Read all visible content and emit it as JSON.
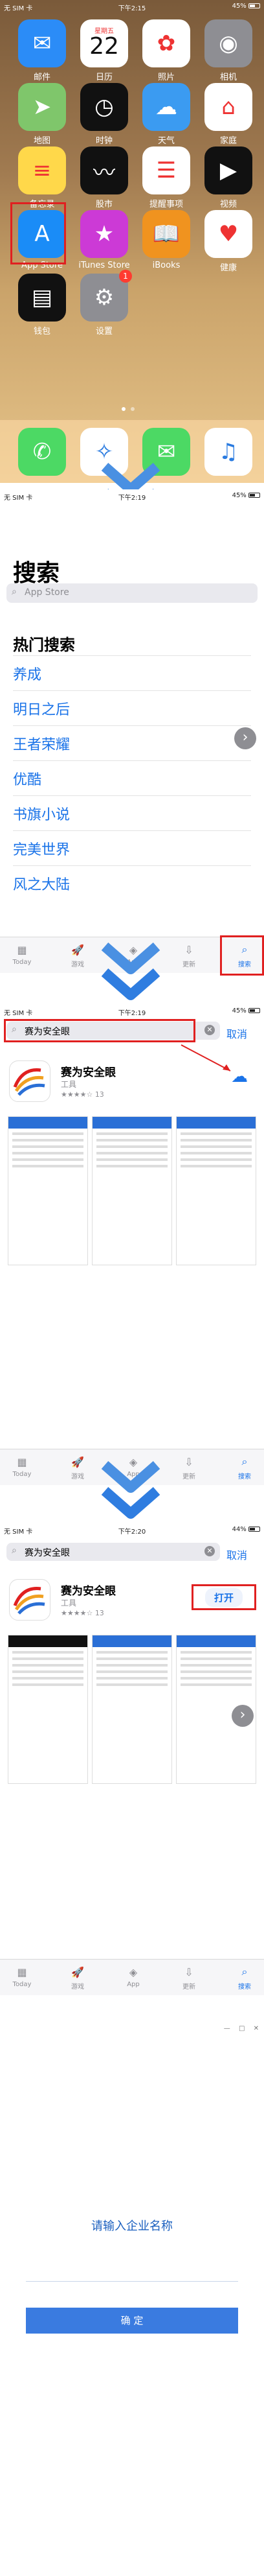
{
  "home": {
    "status": {
      "left": "无 SIM 卡",
      "time": "下午2:15",
      "battery": "45%"
    },
    "apps": [
      {
        "label": "邮件",
        "icon": "mail-icon",
        "color": "#2b8cf7",
        "glyph": "✉"
      },
      {
        "label": "日历",
        "icon": "calendar-icon",
        "color": "#ffffff",
        "glyph": "22",
        "sub": "星期五"
      },
      {
        "label": "照片",
        "icon": "photos-icon",
        "color": "#ffffff",
        "glyph": "✿"
      },
      {
        "label": "相机",
        "icon": "camera-icon",
        "color": "#8e8e93",
        "glyph": "◉"
      },
      {
        "label": "地图",
        "icon": "maps-icon",
        "color": "#7fc66b",
        "glyph": "➤"
      },
      {
        "label": "时钟",
        "icon": "clock-icon",
        "color": "#111111",
        "glyph": "◷"
      },
      {
        "label": "天气",
        "icon": "weather-icon",
        "color": "#3b9bf1",
        "glyph": "☁"
      },
      {
        "label": "家庭",
        "icon": "home-icon",
        "color": "#ffffff",
        "glyph": "⌂"
      },
      {
        "label": "备忘录",
        "icon": "notes-icon",
        "color": "#ffd84a",
        "glyph": "≡"
      },
      {
        "label": "股市",
        "icon": "stocks-icon",
        "color": "#111111",
        "glyph": "〰"
      },
      {
        "label": "提醒事项",
        "icon": "reminders-icon",
        "color": "#ffffff",
        "glyph": "☰"
      },
      {
        "label": "视频",
        "icon": "tv-icon",
        "color": "#111111",
        "glyph": "▶"
      },
      {
        "label": "App Store",
        "icon": "app-store-icon",
        "color": "#1a8cf7",
        "glyph": "A"
      },
      {
        "label": "iTunes Store",
        "icon": "itunes-store-icon",
        "color": "#cc3ad6",
        "glyph": "★"
      },
      {
        "label": "iBooks",
        "icon": "ibooks-icon",
        "color": "#f0931f",
        "glyph": "📖"
      },
      {
        "label": "健康",
        "icon": "health-icon",
        "color": "#ffffff",
        "glyph": "♥"
      },
      {
        "label": "钱包",
        "icon": "wallet-icon",
        "color": "#111111",
        "glyph": "▤"
      },
      {
        "label": "设置",
        "icon": "settings-icon",
        "color": "#8e8e93",
        "glyph": "⚙",
        "badge": "1"
      }
    ],
    "dock": [
      {
        "icon": "phone-icon",
        "color": "#4cd964",
        "glyph": "✆"
      },
      {
        "icon": "safari-icon",
        "color": "#ffffff",
        "glyph": "✧"
      },
      {
        "icon": "messages-icon",
        "color": "#4cd964",
        "glyph": "✉"
      },
      {
        "icon": "music-icon",
        "color": "#ffffff",
        "glyph": "♫"
      }
    ]
  },
  "search_page": {
    "status": {
      "left": "无 SIM 卡",
      "time": "下午2:19",
      "battery": "45%"
    },
    "title": "搜索",
    "placeholder": "App Store",
    "hot_title": "热门搜索",
    "hot_items": [
      "养成",
      "明日之后",
      "王者荣耀",
      "优酷",
      "书旗小说",
      "完美世界",
      "风之大陆"
    ]
  },
  "tabs": [
    {
      "label": "Today",
      "icon": "today-icon",
      "glyph": "▦"
    },
    {
      "label": "游戏",
      "icon": "games-icon",
      "glyph": "🚀"
    },
    {
      "label": "App",
      "icon": "apps-icon",
      "glyph": "◈"
    },
    {
      "label": "更新",
      "icon": "updates-icon",
      "glyph": "⇩"
    },
    {
      "label": "搜索",
      "icon": "search-icon",
      "glyph": "⌕"
    }
  ],
  "result_page": {
    "status": {
      "left": "无 SIM 卡",
      "time": "下午2:19",
      "battery": "45%"
    },
    "query": "赛为安全眼",
    "cancel": "取消",
    "app_name": "赛为安全眼",
    "app_category": "工具",
    "rating": "★★★★☆",
    "rating_count": "13"
  },
  "installed_page": {
    "status": {
      "left": "无 SIM 卡",
      "time": "下午2:20",
      "battery": "44%"
    },
    "query": "赛为安全眼",
    "cancel": "取消",
    "app_name": "赛为安全眼",
    "app_category": "工具",
    "rating": "★★★★☆",
    "rating_count": "13",
    "open_button": "打开"
  },
  "login_page": {
    "prompt": "请输入企业名称",
    "confirm": "确 定"
  },
  "colors": {
    "accent": "#1a73e8",
    "highlight": "#e02020",
    "arrow": "#3a8ff0"
  }
}
